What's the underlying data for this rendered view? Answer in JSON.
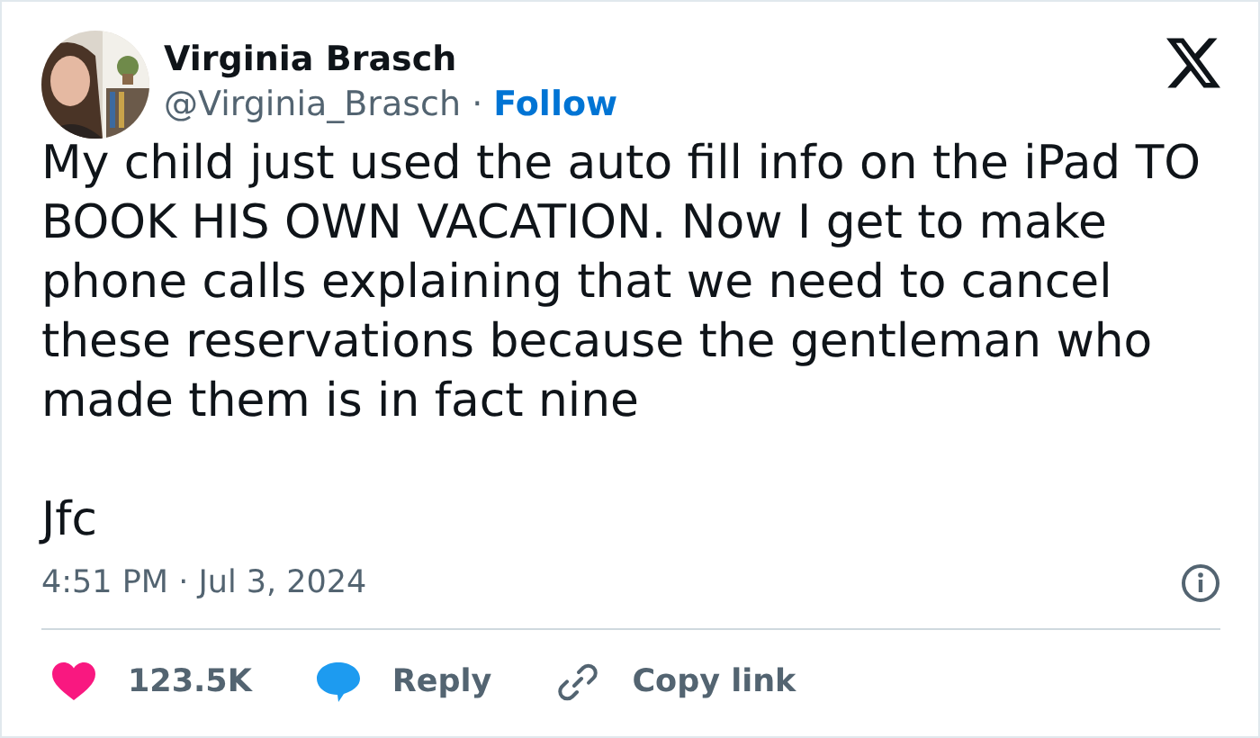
{
  "author": {
    "name": "Virginia Brasch",
    "handle": "@Virginia_Brasch",
    "separator": "·",
    "follow": "Follow"
  },
  "body": [
    "My child just used the auto fill info on the iPad TO BOOK HIS OWN VACATION. Now I get to make phone calls explaining that we need to cancel these reservations because the gentleman who made them is in fact nine",
    "Jfc"
  ],
  "timestamp": "4:51 PM · Jul 3, 2024",
  "actions": [
    {
      "kind": "like",
      "label": "123.5K"
    },
    {
      "kind": "reply",
      "label": "Reply"
    },
    {
      "kind": "copy",
      "label": "Copy link"
    }
  ]
}
